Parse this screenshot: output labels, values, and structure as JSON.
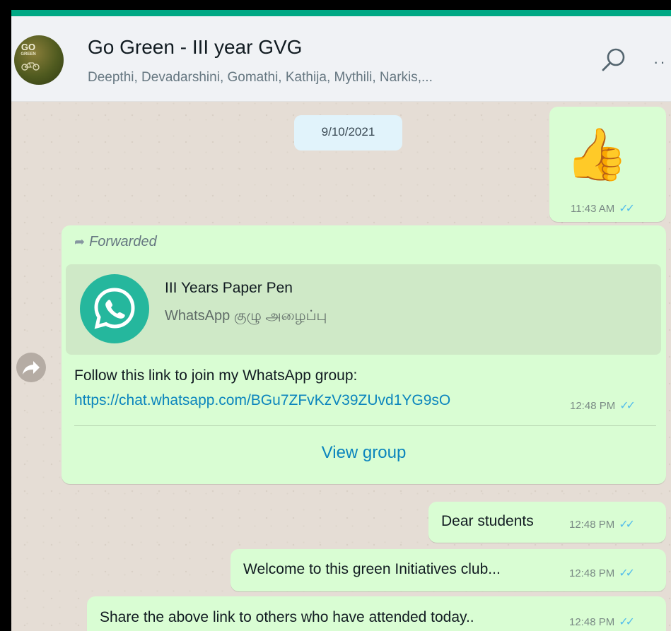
{
  "header": {
    "avatar_text": "GO",
    "avatar_sub": "GREEN",
    "title": "Go Green - III year GVG",
    "participants": "Deepthi, Devadarshini, Gomathi, Kathija, Mythili, Narkis,..."
  },
  "date_divider": "9/10/2021",
  "messages": [
    {
      "kind": "emoji",
      "content": "👍",
      "time": "11:43 AM"
    },
    {
      "kind": "forwarded-link",
      "forwarded_label": "Forwarded",
      "preview_title": "III Years Paper Pen",
      "preview_subtitle": "WhatsApp குழு அழைப்பு",
      "text": "Follow this link to join my WhatsApp group:",
      "link": "https://chat.whatsapp.com/BGu7ZFvKzV39ZUvd1YG9sO",
      "time": "12:48 PM",
      "action_label": "View group"
    },
    {
      "kind": "text",
      "text": "Dear students",
      "time": "12:48 PM"
    },
    {
      "kind": "text",
      "text": "Welcome to this green Initiatives club...",
      "time": "12:48 PM"
    },
    {
      "kind": "text",
      "text": "Share the above link to others who have attended today..",
      "time": "12:48 PM"
    }
  ],
  "colors": {
    "accent": "#00a884",
    "outgoing_bubble": "#d9fdd3",
    "read_ticks": "#53bdeb",
    "link": "#0b85bd"
  },
  "icons": {
    "search": "search-icon",
    "menu": "menu-icon",
    "forward": "forward-arrow-icon",
    "read": "double-check-icon",
    "whatsapp": "whatsapp-logo-icon",
    "share": "share-icon"
  }
}
